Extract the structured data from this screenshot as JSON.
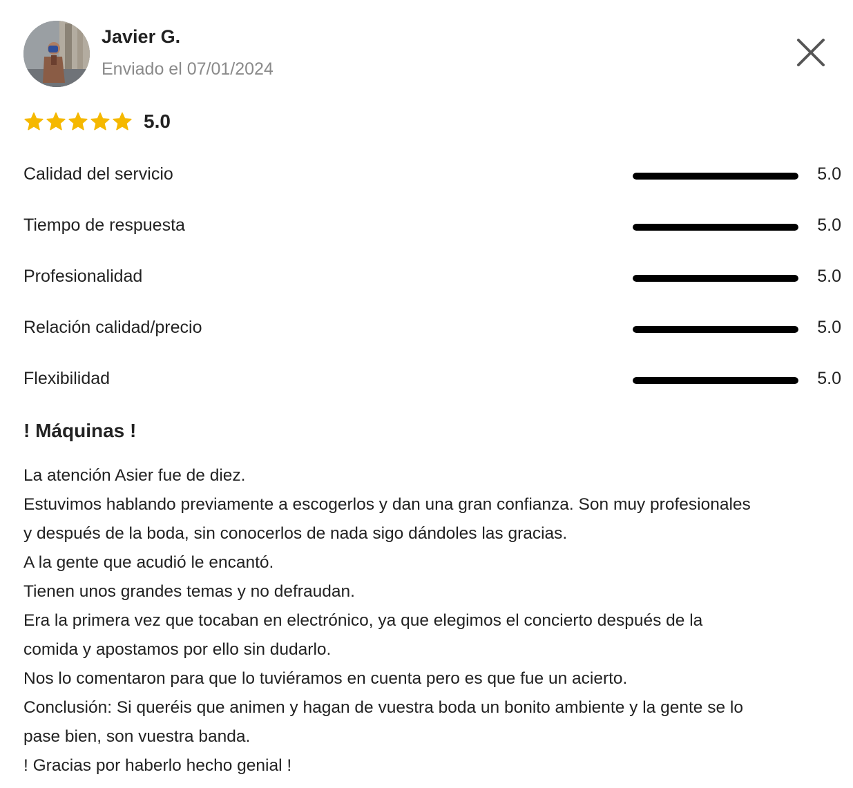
{
  "review": {
    "author": {
      "name": "Javier G.",
      "sent_label": "Enviado el 07/01/2024",
      "avatar": "profile-photo"
    },
    "close_icon": "close-icon",
    "overall": {
      "stars": 5,
      "max_stars": 5,
      "score": "5.0",
      "star_color": "#f5b800"
    },
    "criteria": [
      {
        "label": "Calidad del servicio",
        "score": "5.0",
        "fill": 1.0
      },
      {
        "label": "Tiempo de respuesta",
        "score": "5.0",
        "fill": 1.0
      },
      {
        "label": "Profesionalidad",
        "score": "5.0",
        "fill": 1.0
      },
      {
        "label": "Relación calidad/precio",
        "score": "5.0",
        "fill": 1.0
      },
      {
        "label": "Flexibilidad",
        "score": "5.0",
        "fill": 1.0
      }
    ],
    "title": "! Máquinas !",
    "body_lines": [
      "La atención Asier fue de diez.",
      "Estuvimos hablando previamente a escogerlos y dan una gran confianza. Son muy profesionales",
      "y después de la boda, sin conocerlos de nada sigo dándoles las gracias.",
      "A la gente que acudió le encantó.",
      "Tienen unos grandes temas y no defraudan.",
      "Era la primera vez que tocaban en electrónico, ya que elegimos el concierto después de la",
      "comida y apostamos por ello sin dudarlo.",
      "Nos lo comentaron para que lo tuviéramos en cuenta pero es que fue un acierto.",
      "Conclusión: Si queréis que animen y hagan de vuestra boda un bonito ambiente y la gente se lo",
      "pase bien, son vuestra banda.",
      "! Gracias por haberlo hecho genial !"
    ]
  }
}
